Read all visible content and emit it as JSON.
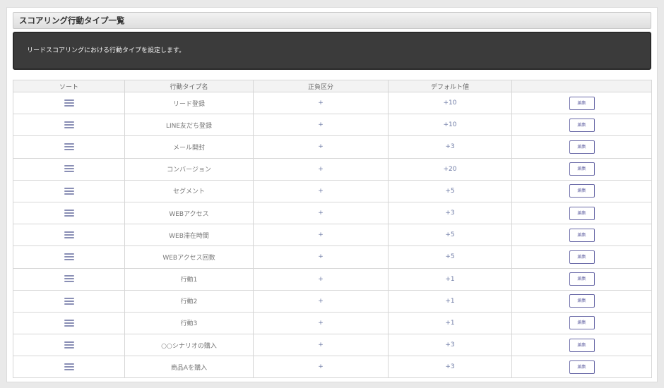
{
  "page": {
    "title": "スコアリング行動タイプ一覧",
    "description": "リードスコアリングにおける行動タイプを設定します。"
  },
  "table": {
    "headers": {
      "sort": "ソート",
      "name": "行動タイプ名",
      "sign": "正負区分",
      "default": "デフォルト値",
      "actions": ""
    },
    "edit_label": "編集",
    "sort_icon": "drag-handle-icon",
    "rows": [
      {
        "name": "リード登録",
        "sign": "+",
        "default": "+10"
      },
      {
        "name": "LINE友だち登録",
        "sign": "+",
        "default": "+10"
      },
      {
        "name": "メール開封",
        "sign": "+",
        "default": "+3"
      },
      {
        "name": "コンバージョン",
        "sign": "+",
        "default": "+20"
      },
      {
        "name": "セグメント",
        "sign": "+",
        "default": "+5"
      },
      {
        "name": "WEBアクセス",
        "sign": "+",
        "default": "+3"
      },
      {
        "name": "WEB滞在時間",
        "sign": "+",
        "default": "+5"
      },
      {
        "name": "WEBアクセス回数",
        "sign": "+",
        "default": "+5"
      },
      {
        "name": "行動1",
        "sign": "+",
        "default": "+1"
      },
      {
        "name": "行動2",
        "sign": "+",
        "default": "+1"
      },
      {
        "name": "行動3",
        "sign": "+",
        "default": "+1"
      },
      {
        "name": "○○シナリオの購入",
        "sign": "+",
        "default": "+3"
      },
      {
        "name": "商品Aを購入",
        "sign": "+",
        "default": "+3"
      }
    ]
  },
  "colors": {
    "header_bar": "#3b3b3b",
    "accent": "#6b6ba8",
    "sort_icon": "#8a8fb5"
  }
}
